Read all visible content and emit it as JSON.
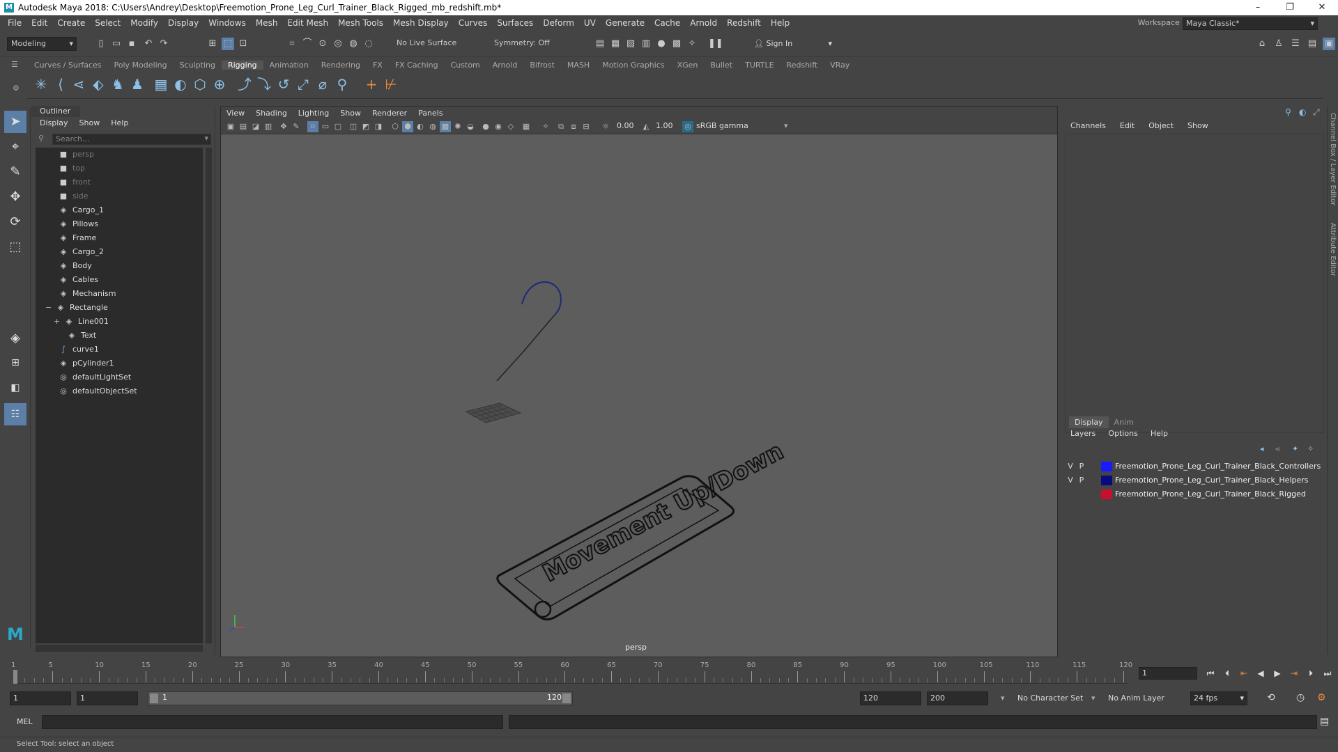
{
  "window": {
    "title": "Autodesk Maya 2018: C:\\Users\\Andrey\\Desktop\\Freemotion_Prone_Leg_Curl_Trainer_Black_Rigged_mb_redshift.mb*",
    "minimize": "–",
    "maximize": "❐",
    "close": "✕"
  },
  "menubar": [
    "File",
    "Edit",
    "Create",
    "Select",
    "Modify",
    "Display",
    "Windows",
    "Mesh",
    "Edit Mesh",
    "Mesh Tools",
    "Mesh Display",
    "Curves",
    "Surfaces",
    "Deform",
    "UV",
    "Generate",
    "Cache",
    "Arnold",
    "Redshift",
    "Help"
  ],
  "workspace": {
    "label": "Workspace :",
    "value": "Maya Classic*"
  },
  "statusline": {
    "mode": "Modeling",
    "live_surface": "No Live Surface",
    "symmetry": "Symmetry: Off",
    "sign_in": "Sign In"
  },
  "shelf_tabs": [
    "Curves / Surfaces",
    "Poly Modeling",
    "Sculpting",
    "Rigging",
    "Animation",
    "Rendering",
    "FX",
    "FX Caching",
    "Custom",
    "Arnold",
    "Bifrost",
    "MASH",
    "Motion Graphics",
    "XGen",
    "Bullet",
    "TURTLE",
    "Redshift",
    "VRay"
  ],
  "shelf_active": "Rigging",
  "outliner": {
    "title": "Outliner",
    "menu": [
      "Display",
      "Show",
      "Help"
    ],
    "search_placeholder": "Search...",
    "items": [
      {
        "label": "persp",
        "icon": "camera-icon",
        "dim": true
      },
      {
        "label": "top",
        "icon": "camera-icon",
        "dim": true
      },
      {
        "label": "front",
        "icon": "camera-icon",
        "dim": true
      },
      {
        "label": "side",
        "icon": "camera-icon",
        "dim": true
      },
      {
        "label": "Cargo_1",
        "icon": "transform-icon"
      },
      {
        "label": "Pillows",
        "icon": "transform-icon"
      },
      {
        "label": "Frame",
        "icon": "transform-icon"
      },
      {
        "label": "Cargo_2",
        "icon": "transform-icon"
      },
      {
        "label": "Body",
        "icon": "transform-icon"
      },
      {
        "label": "Cables",
        "icon": "transform-icon"
      },
      {
        "label": "Mechanism",
        "icon": "transform-icon"
      },
      {
        "label": "Rectangle",
        "icon": "transform-icon",
        "expand": "−"
      },
      {
        "label": "Line001",
        "icon": "transform-icon",
        "expand": "+"
      },
      {
        "label": "Text",
        "icon": "transform-icon"
      },
      {
        "label": "curve1",
        "icon": "curve-icon"
      },
      {
        "label": "pCylinder1",
        "icon": "transform-icon"
      },
      {
        "label": "defaultLightSet",
        "icon": "set-icon"
      },
      {
        "label": "defaultObjectSet",
        "icon": "set-icon"
      }
    ]
  },
  "viewport": {
    "menu": [
      "View",
      "Shading",
      "Lighting",
      "Show",
      "Renderer",
      "Panels"
    ],
    "exposure": "0.00",
    "gamma": "1.00",
    "color_space": "sRGB gamma",
    "camera_label": "persp",
    "scene_text": "Movement Up/Down"
  },
  "channelbox": {
    "menu": [
      "Channels",
      "Edit",
      "Object",
      "Show"
    ],
    "layer_tabs": [
      "Display",
      "Anim"
    ],
    "layer_menu": [
      "Layers",
      "Options",
      "Help"
    ],
    "layers": [
      {
        "v": "V",
        "p": "P",
        "color": "#1a1aff",
        "name": "Freemotion_Prone_Leg_Curl_Trainer_Black_Controllers"
      },
      {
        "v": "V",
        "p": "P",
        "color": "#0a0a80",
        "name": "Freemotion_Prone_Leg_Curl_Trainer_Black_Helpers"
      },
      {
        "v": "",
        "p": "",
        "color": "#c8102e",
        "name": "Freemotion_Prone_Leg_Curl_Trainer_Black_Rigged"
      }
    ]
  },
  "side_strip": [
    "Channel Box / Layer Editor",
    "Attribute Editor"
  ],
  "timeline": {
    "ticks": [
      "1",
      "5",
      "10",
      "15",
      "20",
      "25",
      "30",
      "35",
      "40",
      "45",
      "50",
      "55",
      "60",
      "65",
      "70",
      "75",
      "80",
      "85",
      "90",
      "95",
      "100",
      "105",
      "110",
      "115",
      "120"
    ],
    "current_frame": "1"
  },
  "range": {
    "start": "1",
    "playback_start": "1",
    "slider_start": "1",
    "slider_end": "120",
    "playback_end": "120",
    "end": "200",
    "character_set": "No Character Set",
    "anim_layer": "No Anim Layer",
    "fps": "24 fps"
  },
  "cmdline": {
    "label": "MEL"
  },
  "status": "Select Tool: select an object"
}
